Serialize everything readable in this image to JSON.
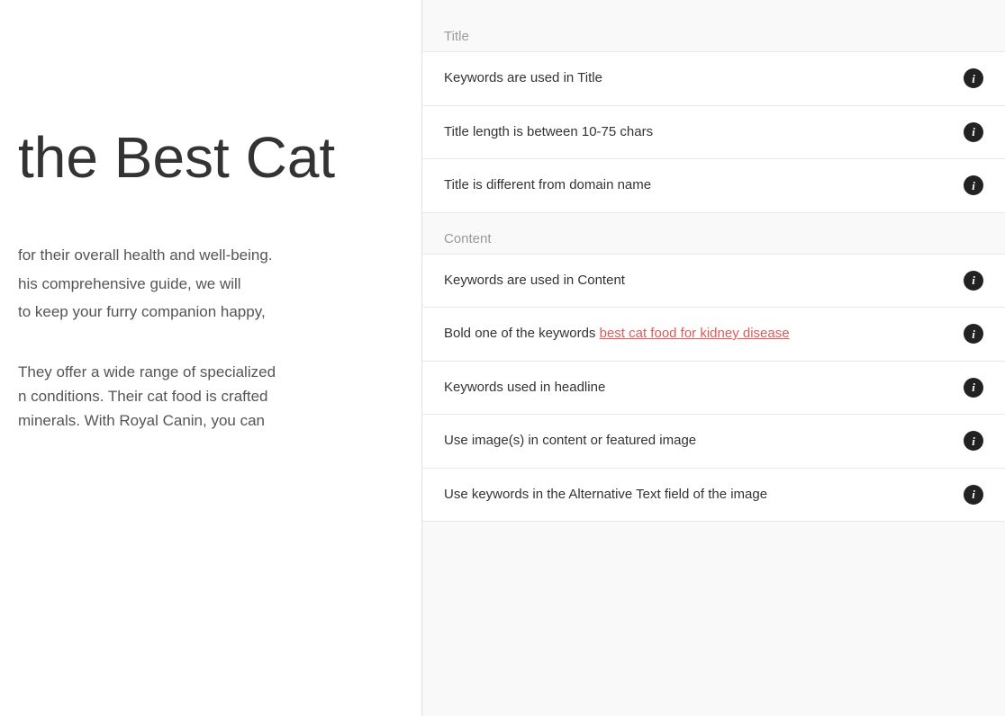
{
  "left": {
    "title": "the Best Cat",
    "paragraph1_line1": "for their overall health and well-being.",
    "paragraph1_line2": "his comprehensive guide, we will",
    "paragraph1_line3": "to keep your furry companion happy,",
    "paragraph2_line1": "They offer a wide range of specialized",
    "paragraph2_line2": "n conditions. Their cat food is crafted",
    "paragraph2_line3": "minerals. With Royal Canin, you can"
  },
  "right": {
    "section_title": {
      "label": "Title",
      "items": [
        {
          "id": "keywords-in-title",
          "text": "Keywords are used in Title",
          "has_link": false,
          "link_text": "",
          "info_label": "i"
        },
        {
          "id": "title-length",
          "text": "Title length is between 10-75 chars",
          "has_link": false,
          "link_text": "",
          "info_label": "i"
        },
        {
          "id": "title-different-domain",
          "text": "Title is different from domain name",
          "has_link": false,
          "link_text": "",
          "info_label": "i"
        }
      ]
    },
    "section_content": {
      "label": "Content",
      "items": [
        {
          "id": "keywords-in-content",
          "text": "Keywords are used in Content",
          "has_link": false,
          "link_text": "",
          "pre_link": "",
          "info_label": "i"
        },
        {
          "id": "bold-keywords",
          "text": "Bold one of the keywords ",
          "has_link": true,
          "link_text": "best cat food for kidney disease",
          "pre_link": "Bold one of the keywords ",
          "info_label": "i"
        },
        {
          "id": "keywords-in-headline",
          "text": "Keywords used in headline",
          "has_link": false,
          "link_text": "",
          "info_label": "i"
        },
        {
          "id": "use-images",
          "text": "Use image(s) in content or featured image",
          "has_link": false,
          "link_text": "",
          "info_label": "i"
        },
        {
          "id": "alt-text",
          "text": "Use keywords in the Alternative Text field of the image",
          "has_link": false,
          "link_text": "",
          "info_label": "i"
        }
      ]
    }
  }
}
